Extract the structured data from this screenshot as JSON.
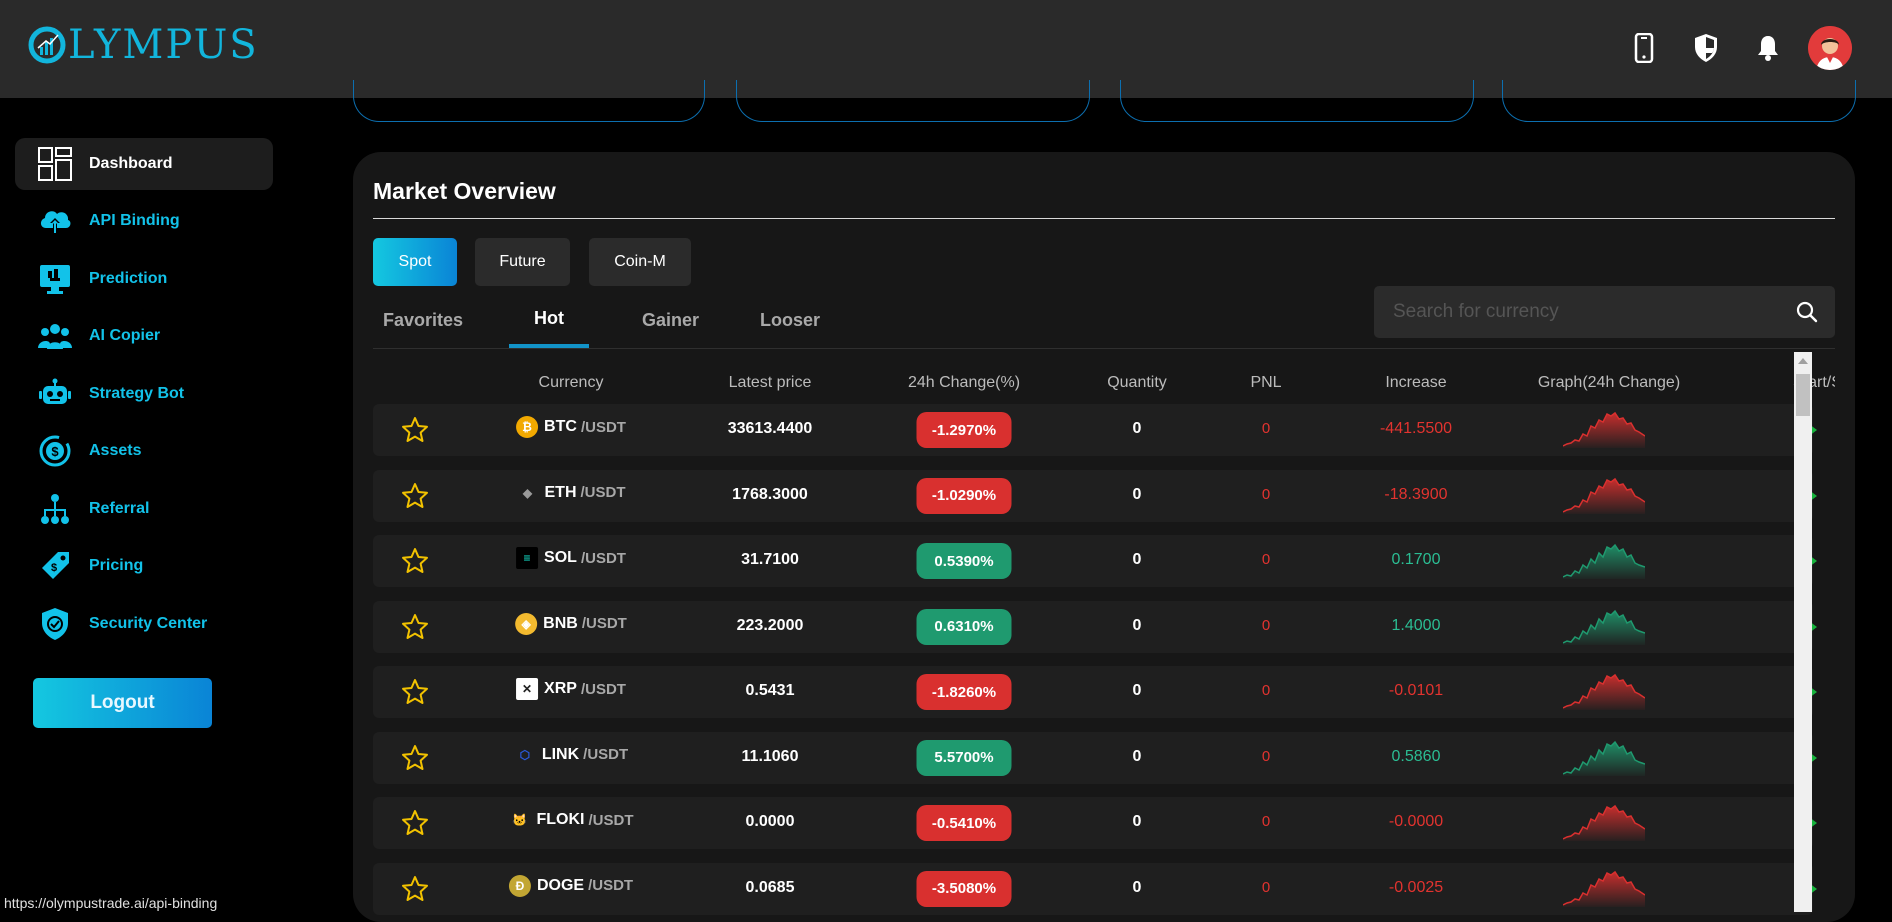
{
  "brand": {
    "logo_text": "LYMPUS"
  },
  "header": {
    "icons": [
      "phone-icon",
      "shield-icon",
      "bell-icon",
      "avatar"
    ]
  },
  "sidebar": {
    "items": [
      {
        "label": "Dashboard",
        "icon": "dashboard-icon",
        "active": true
      },
      {
        "label": "API Binding",
        "icon": "cloud-upload-icon"
      },
      {
        "label": "Prediction",
        "icon": "monitor-icon"
      },
      {
        "label": "AI Copier",
        "icon": "users-icon"
      },
      {
        "label": "Strategy Bot",
        "icon": "robot-icon"
      },
      {
        "label": "Assets",
        "icon": "dollar-coin-icon"
      },
      {
        "label": "Referral",
        "icon": "network-icon"
      },
      {
        "label": "Pricing",
        "icon": "price-tag-icon"
      },
      {
        "label": "Security Center",
        "icon": "security-shield-icon"
      }
    ],
    "logout_label": "Logout"
  },
  "market": {
    "title": "Market Overview",
    "segments": [
      "Spot",
      "Future",
      "Coin-M"
    ],
    "active_segment": "Spot",
    "tabs": [
      "Favorites",
      "Hot",
      "Gainer",
      "Looser"
    ],
    "active_tab": "Hot",
    "search_placeholder": "Search for currency",
    "columns": [
      "Currency",
      "Latest price",
      "24h Change(%)",
      "Quantity",
      "PNL",
      "Increase",
      "Graph(24h Change)",
      "Start/S"
    ],
    "quote": "/USDT",
    "rows": [
      {
        "symbol": "BTC",
        "price": "33613.4400",
        "change": "-1.2970%",
        "quantity": "0",
        "pnl": "0",
        "increase": "-441.5500",
        "direction": "down"
      },
      {
        "symbol": "ETH",
        "price": "1768.3000",
        "change": "-1.0290%",
        "quantity": "0",
        "pnl": "0",
        "increase": "-18.3900",
        "direction": "down"
      },
      {
        "symbol": "SOL",
        "price": "31.7100",
        "change": "0.5390%",
        "quantity": "0",
        "pnl": "0",
        "increase": "0.1700",
        "direction": "up"
      },
      {
        "symbol": "BNB",
        "price": "223.2000",
        "change": "0.6310%",
        "quantity": "0",
        "pnl": "0",
        "increase": "1.4000",
        "direction": "up"
      },
      {
        "symbol": "XRP",
        "price": "0.5431",
        "change": "-1.8260%",
        "quantity": "0",
        "pnl": "0",
        "increase": "-0.0101",
        "direction": "down"
      },
      {
        "symbol": "LINK",
        "price": "11.1060",
        "change": "5.5700%",
        "quantity": "0",
        "pnl": "0",
        "increase": "0.5860",
        "direction": "up"
      },
      {
        "symbol": "FLOKI",
        "price": "0.0000",
        "change": "-0.5410%",
        "quantity": "0",
        "pnl": "0",
        "increase": "-0.0000",
        "direction": "down"
      },
      {
        "symbol": "DOGE",
        "price": "0.0685",
        "change": "-3.5080%",
        "quantity": "0",
        "pnl": "0",
        "increase": "-0.0025",
        "direction": "down"
      }
    ]
  },
  "colors": {
    "accent": "#12c2e9",
    "up": "#1f9a6f",
    "down": "#d9302f",
    "up_text": "#2bbd93",
    "down_text": "#e2332f",
    "play": "#17b33d"
  },
  "status_bar": {
    "url": "https://olympustrade.ai/api-binding"
  }
}
